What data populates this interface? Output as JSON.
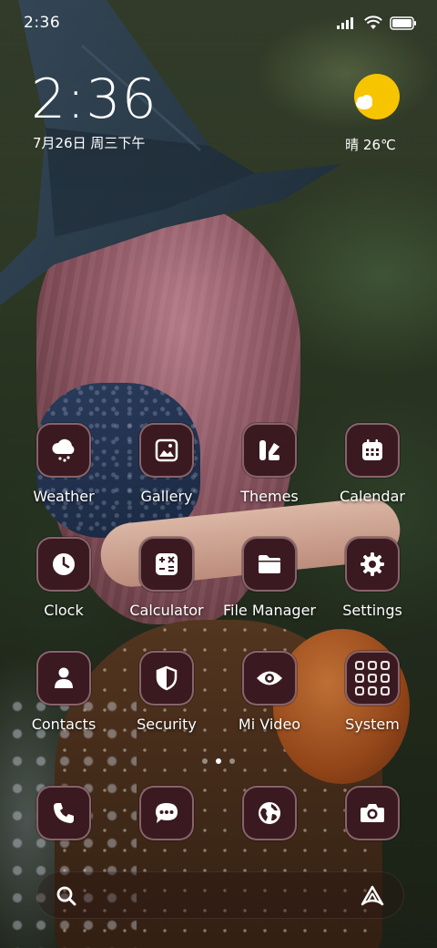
{
  "status_bar": {
    "time": "2:36",
    "icons": [
      "signal-icon",
      "wifi-icon",
      "battery-icon"
    ]
  },
  "clock_widget": {
    "time": "2:36",
    "date": "7月26日 周三下午"
  },
  "weather_widget": {
    "icon": "sunny-cloud-icon",
    "text": "晴 26℃"
  },
  "apps": [
    {
      "label": "Weather",
      "icon": "cloud-rain-icon"
    },
    {
      "label": "Gallery",
      "icon": "image-icon"
    },
    {
      "label": "Themes",
      "icon": "themes-icon"
    },
    {
      "label": "Calendar",
      "icon": "calendar-icon"
    },
    {
      "label": "Clock",
      "icon": "clock-icon"
    },
    {
      "label": "Calculator",
      "icon": "calculator-icon"
    },
    {
      "label": "File Manager",
      "icon": "folder-icon"
    },
    {
      "label": "Settings",
      "icon": "gear-icon"
    },
    {
      "label": "Contacts",
      "icon": "person-icon"
    },
    {
      "label": "Security",
      "icon": "shield-icon"
    },
    {
      "label": "Mi Video",
      "icon": "eye-icon"
    },
    {
      "label": "System",
      "icon": "folder-grid-icon"
    }
  ],
  "page_indicator": {
    "pages": 3,
    "active_page": 2
  },
  "dock": [
    {
      "icon": "phone-icon"
    },
    {
      "icon": "message-icon"
    },
    {
      "icon": "globe-icon"
    },
    {
      "icon": "camera-icon"
    }
  ],
  "search_bar": {
    "icons": [
      "search-icon",
      "assistant-icon"
    ]
  },
  "colors": {
    "icon_background": "#3a1a20",
    "icon_border": "#c8a0aa",
    "sun": "#f7c400"
  }
}
